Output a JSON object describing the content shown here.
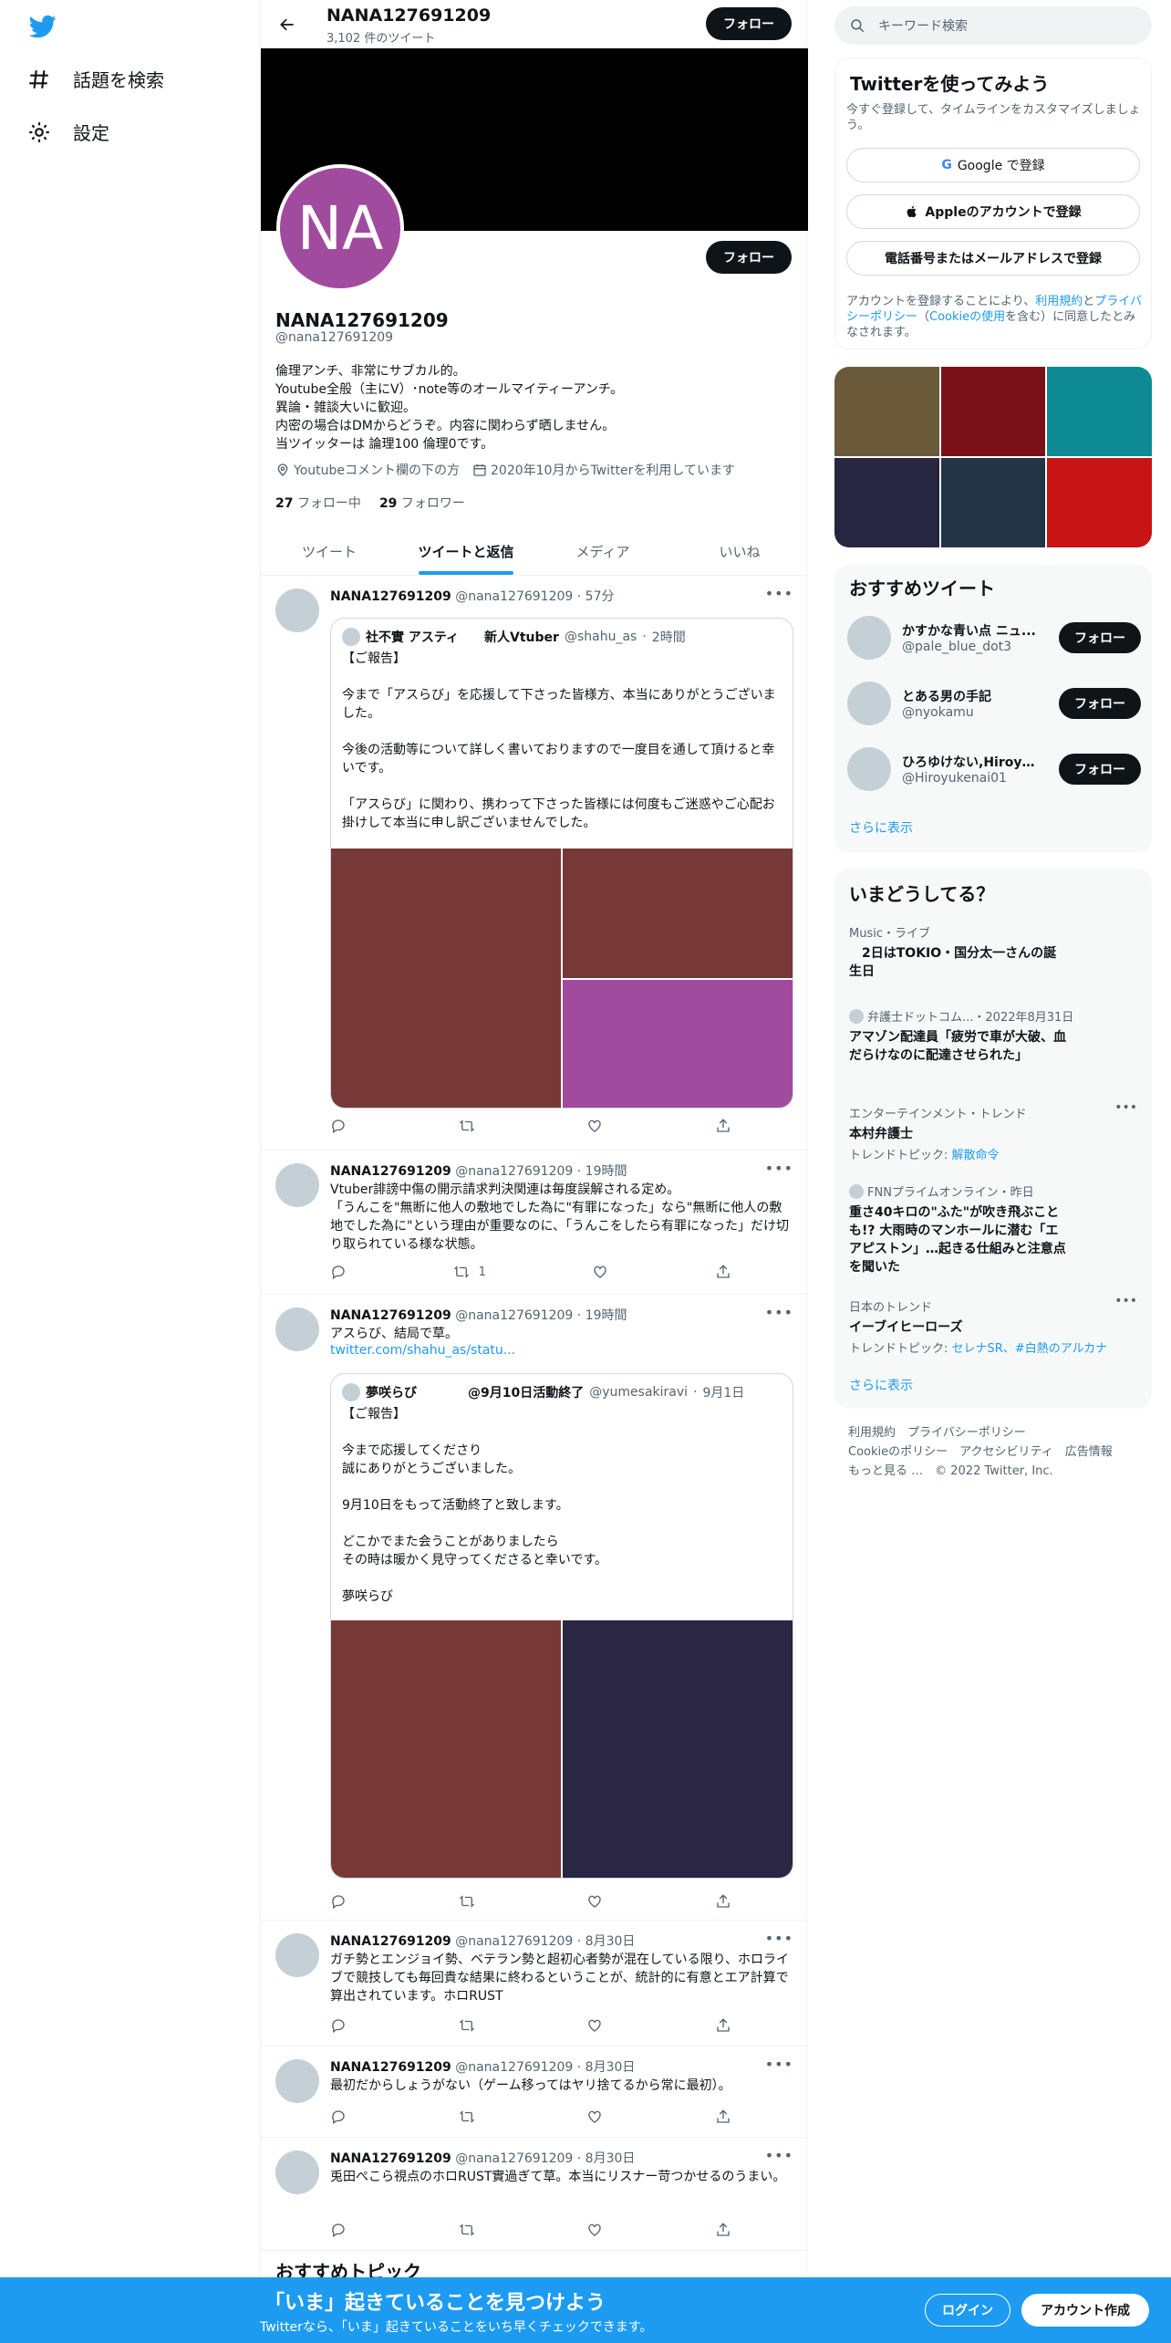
{
  "left_nav": {
    "explore_label": "話題を検索",
    "settings_label": "設定"
  },
  "header": {
    "name": "NANA127691209",
    "tweet_count": "3,102 件のツイート",
    "follow_label": "フォロー"
  },
  "profile": {
    "avatar_text": "NA",
    "name": "NANA127691209",
    "handle": "@nana127691209",
    "follow_label": "フォロー",
    "bio": "倫理アンチ、非常にサブカル的。\nYoutube全般（主にV）･note等のオールマイティーアンチ。\n異論・雑談大いに歓迎。\n内密の場合はDMからどうぞ。内容に関わらず晒しません。\n当ツイッターは 論理100 倫理0です。",
    "location": "Youtubeコメント欄の下の方",
    "joined": "2020年10月からTwitterを利用しています",
    "following_count": "27",
    "following_label": "フォロー中",
    "followers_count": "29",
    "followers_label": "フォロワー"
  },
  "tabs": [
    {
      "label": "ツイート"
    },
    {
      "label": "ツイートと返信"
    },
    {
      "label": "メディア"
    },
    {
      "label": "いいね"
    }
  ],
  "tweets": [
    {
      "name": "NANA127691209",
      "handle": "@nana127691209",
      "time": "57分",
      "quote": {
        "name": "社不實 アスティ　　新人Vtuber",
        "handle": "@shahu_as",
        "time": "2時間",
        "text": "【ご報告】\n\n今まで「アスらび」を応援して下さった皆様方、本当にありがとうございました。\n\n今後の活動等について詳しく書いておりますので一度目を通して頂けると幸いです。\n\n「アスらび」に関わり、携わって下さった皆様には何度もご迷惑やご心配お掛けして本当に申し訳ございませんでした。"
      }
    },
    {
      "name": "NANA127691209",
      "handle": "@nana127691209",
      "time": "19時間",
      "text": "Vtuber誹謗中傷の開示請求判決関連は毎度誤解される定め。\n「うんこを\"無断に他人の敷地でした為に\"有罪になった」なら\"無断に他人の敷地でした為に\"という理由が重要なのに、「うんこをしたら有罪になった」だけ切り取られている様な状態。",
      "retweets": "1"
    },
    {
      "name": "NANA127691209",
      "handle": "@nana127691209",
      "time": "19時間",
      "text": "アスらび、結局で草。",
      "link": "twitter.com/shahu_as/statu...",
      "quote": {
        "name": "夢咲らび　　　　@9月10日活動終了",
        "handle": "@yumesakiravi",
        "time": "9月1日",
        "text": "【ご報告】\n\n今まで応援してくださり\n誠にありがとうございました。\n\n9月10日をもって活動終了と致します。\n\nどこかでまた会うことがありましたら\nその時は暖かく見守ってくださると幸いです。\n\n夢咲らび"
      }
    },
    {
      "name": "NANA127691209",
      "handle": "@nana127691209",
      "time": "8月30日",
      "text": "ガチ勢とエンジョイ勢、ベテラン勢と超初心者勢が混在している限り、ホロライブで競技しても毎回貴な結果に終わるということが、統計的に有意とエア計算で算出されています。ホロRUST"
    },
    {
      "name": "NANA127691209",
      "handle": "@nana127691209",
      "time": "8月30日",
      "text": "最初だからしょうがない（ゲーム移ってはヤリ捨てるから常に最初）。"
    },
    {
      "name": "NANA127691209",
      "handle": "@nana127691209",
      "time": "8月30日",
      "text": "兎田ぺこら視点のホロRUST實過ぎて草。本当にリスナー苛つかせるのうまい。"
    }
  ],
  "more_topics_title": "おすすめトピック",
  "search": {
    "placeholder": "キーワード検索"
  },
  "signup": {
    "title": "Twitterを使ってみよう",
    "subtitle": "今すぐ登録して、タイムラインをカスタマイズしましょう。",
    "google": "Google で登録",
    "apple": "Appleのアカウントで登録",
    "phone": "電話番号またはメールアドレスで登録",
    "terms_prefix": "アカウントを登録することにより、",
    "terms_link": "利用規約",
    "and": "と",
    "privacy_link": "プライバシーポリシー",
    "cookie_link": "Cookieの使用",
    "terms_suffix": "を含む）に同意したとみなされます。",
    "cookie_prefix": "（"
  },
  "media_grid_colors": [
    "#6b5a3a",
    "#7a1118",
    "#0e8a94",
    "#262640",
    "#233444",
    "#c81414"
  ],
  "recommended": {
    "title": "おすすめツイート",
    "items": [
      {
        "name": "かすかな青い点 ニュ...",
        "handle": "@pale_blue_dot3",
        "follow": "フォロー"
      },
      {
        "name": "とある男の手記",
        "handle": "@nyokamu",
        "follow": "フォロー"
      },
      {
        "name": "ひろゆけない,Hiroyu...",
        "handle": "@Hiroyukenai01",
        "follow": "フォロー"
      }
    ],
    "more": "さらに表示"
  },
  "trends": {
    "title": "いまどうしてる？",
    "items": [
      {
        "meta": "Music・ライブ",
        "title": "　2日はTOKIO・国分太一さんの誕生日"
      },
      {
        "meta": "弁護士ドットコム...・2022年8月31日",
        "title": "アマゾン配達員「疲労で車が大破、血だらけなのに配達させられた」"
      },
      {
        "meta": "エンターテインメント・トレンド",
        "title": "本村弁護士",
        "topic_prefix": "トレンドトピック: ",
        "topic": "解散命令"
      },
      {
        "meta": "FNNプライムオンライン・昨日",
        "title": "重さ40キロの\"ふた\"が吹き飛ぶことも!? 大雨時のマンホールに潜む「エアピストン」…起きる仕組みと注意点を聞いた"
      },
      {
        "meta": "日本のトレンド",
        "title": "イーブイヒーローズ",
        "topic_prefix": "トレンドトピック: ",
        "topic": "セレナSR、#白熱のアルカナ"
      }
    ],
    "more": "さらに表示"
  },
  "footer": {
    "line1": "利用規約　プライバシーポリシー",
    "line2": "Cookieのポリシー　アクセシビリティ　広告情報",
    "line3": "もっと見る …　© 2022 Twitter, Inc."
  },
  "bottom_bar": {
    "title": "「いま」起きていることを見つけよう",
    "subtitle": "Twitterなら、「いま」起きていることをいち早くチェックできます。",
    "login": "ログイン",
    "signup": "アカウント作成"
  },
  "colors": {
    "accent": "#1d9bf0",
    "avatar_purple": "#a04b9e",
    "media_brown": "#773838",
    "media_purple": "#a04b9e",
    "media_navy": "#2b2641"
  }
}
